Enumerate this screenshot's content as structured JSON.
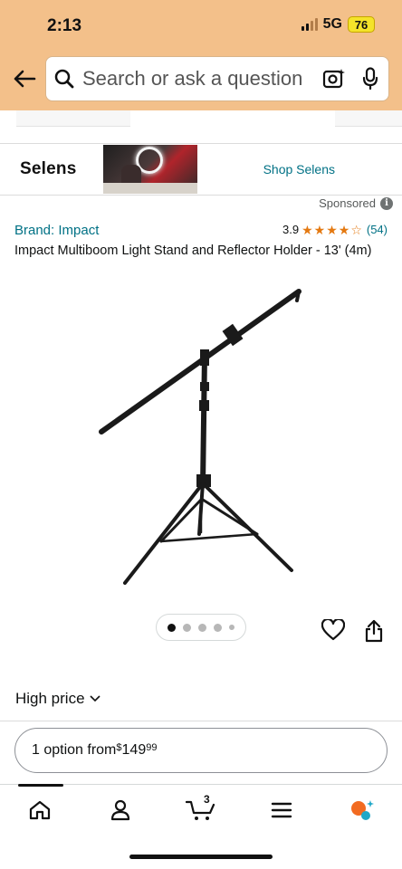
{
  "status_bar": {
    "time": "2:13",
    "network": "5G",
    "battery": "76"
  },
  "header": {
    "search_placeholder": "Search or ask a question",
    "icons": [
      "back-arrow-icon",
      "search-icon",
      "camera-lens-icon",
      "microphone-icon"
    ],
    "background_color": "#f3c08a"
  },
  "sponsor_banner": {
    "brand_name": "Selens",
    "shop_link": "Shop Selens",
    "sponsored_label": "Sponsored"
  },
  "product": {
    "brand_link": "Brand: Impact",
    "rating_value": "3.9",
    "review_count": "(54)",
    "rating_stars": 3.9,
    "title": "Impact Multiboom Light Stand and Reflector Holder - 13' (4m)",
    "image_count": 5,
    "active_image_index": 0
  },
  "pricing": {
    "high_price_label": "High price",
    "option_prefix": "1 option from ",
    "currency": "$",
    "price_dollars": "149",
    "price_cents": "99"
  },
  "bottom_nav": {
    "cart_count": "3",
    "items": [
      "home-icon",
      "account-icon",
      "cart-icon",
      "menu-icon",
      "ai-assistant-icon"
    ]
  },
  "colors": {
    "link": "#007185",
    "star": "#e47911"
  }
}
